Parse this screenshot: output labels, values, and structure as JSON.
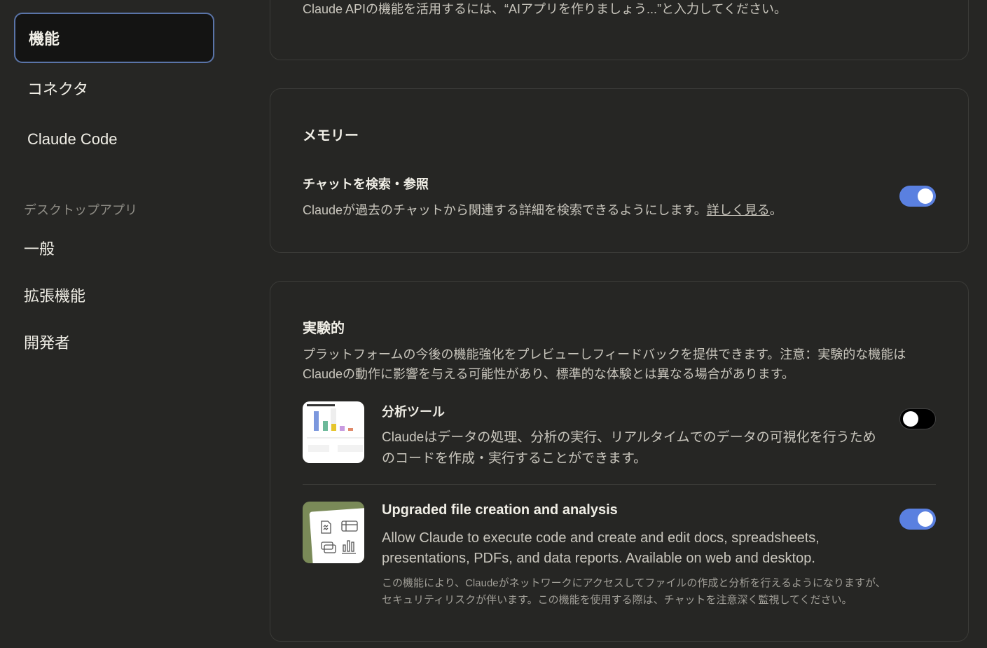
{
  "nav": {
    "items": [
      {
        "label": "機能",
        "active": true
      },
      {
        "label": "コネクタ"
      },
      {
        "label": "Claude Code"
      }
    ],
    "desktop_section": "デスクトップアプリ",
    "desktop_items": [
      "一般",
      "拡張機能",
      "開発者"
    ]
  },
  "top_card": {
    "text": "Claude APIの機能を活用するには、“AIアプリを作りましょう...”と入力してください。"
  },
  "memory": {
    "title": "メモリー",
    "setting_title": "チャットを検索・参照",
    "setting_desc": "Claudeが過去のチャットから関連する詳細を検索できるようにします。",
    "link": "詳しく見る",
    "after_link": "。",
    "enabled": true
  },
  "experimental": {
    "title": "実験的",
    "desc": "プラットフォームの今後の機能強化をプレビューしフィードバックを提供できます。注意：実験的な機能はClaudeの動作に影響を与える可能性があり、標準的な体験とは異なる場合があります。",
    "features": [
      {
        "title": "分析ツール",
        "desc": "Claudeはデータの処理、分析の実行、リアルタイムでのデータの可視化を行うためのコードを作成・実行することができます。",
        "enabled": false
      },
      {
        "title": "Upgraded file creation and analysis",
        "desc": "Allow Claude to execute code and create and edit docs, spreadsheets, presentations, PDFs, and data reports. Available on web and desktop.",
        "note": "この機能により、Claudeがネットワークにアクセスしてファイルの作成と分析を行えるようになりますが、セキュリティリスクが伴います。この機能を使用する際は、チャットを注意深く監視してください。",
        "enabled": true
      }
    ]
  },
  "colors": {
    "accent": "#5a80e0",
    "background": "#262624",
    "thumb_green": "#7a8a58"
  }
}
